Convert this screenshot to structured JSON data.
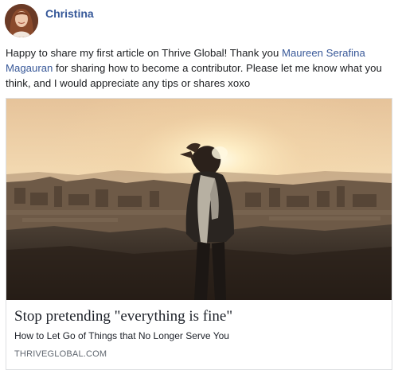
{
  "post": {
    "author": "Christina",
    "text_before_mention": "Happy to share my first article on Thrive Global! Thank you ",
    "mention": "Maureen Serafina Magauran",
    "text_after_mention": " for sharing how to become a contributor. Please let me know what you think, and I would appreciate any tips or shares xoxo"
  },
  "link_preview": {
    "title": "Stop pretending \"everything is fine\"",
    "description": "How to Let Go of Things that No Longer Serve You",
    "domain": "THRIVEGLOBAL.COM"
  },
  "colors": {
    "author_link": "#365899",
    "mention_link": "#385898",
    "domain_text": "#606770",
    "card_border": "#dddfe2"
  }
}
